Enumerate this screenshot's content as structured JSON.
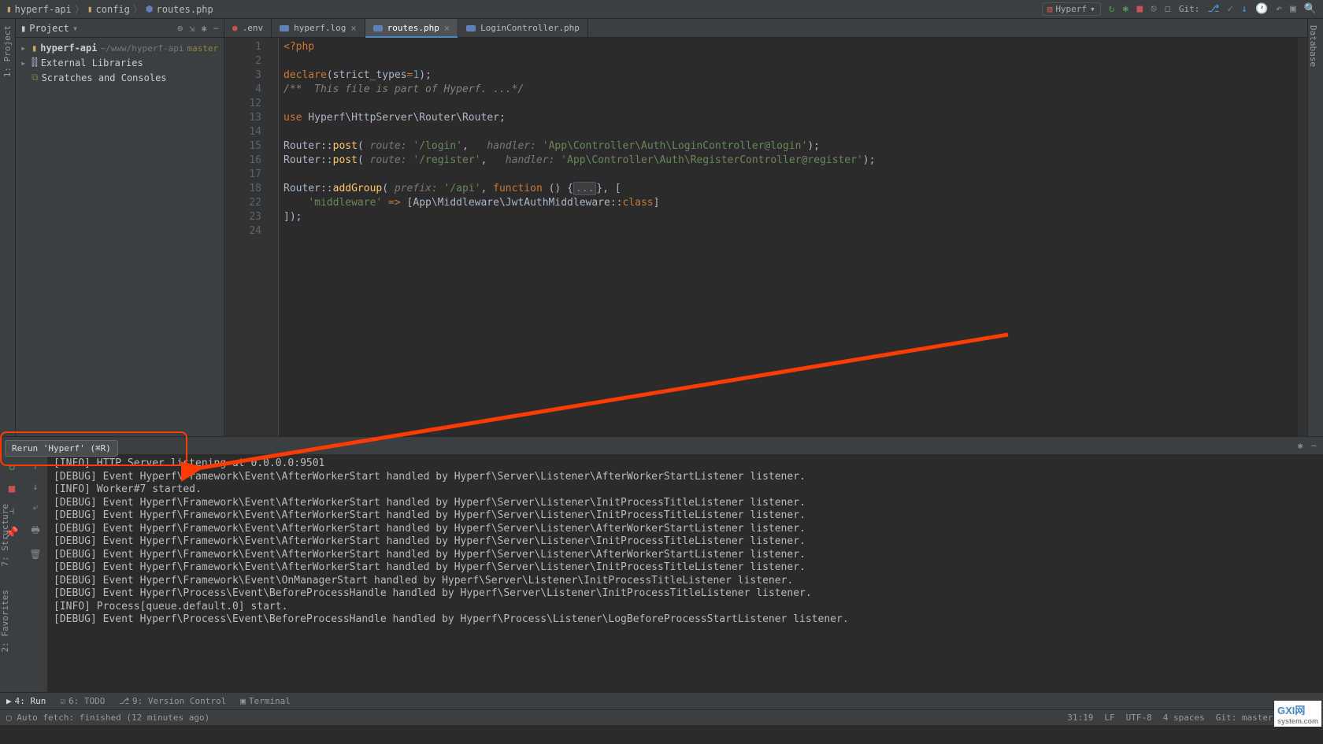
{
  "breadcrumbs": {
    "p1": "hyperf-api",
    "p2": "config",
    "p3": "routes.php"
  },
  "top_right": {
    "run_config": "Hyperf",
    "git_label": "Git:"
  },
  "project_header": {
    "title": "Project"
  },
  "tree": {
    "root_name": "hyperf-api",
    "root_path": "~/www/hyperf-api",
    "root_branch": "master",
    "ext_lib": "External Libraries",
    "scratches": "Scratches and Consoles"
  },
  "tabs": [
    {
      "name": ".env"
    },
    {
      "name": "hyperf.log"
    },
    {
      "name": "routes.php"
    },
    {
      "name": "LoginController.php"
    }
  ],
  "line_numbers": [
    "1",
    "2",
    "3",
    "4",
    "12",
    "13",
    "14",
    "15",
    "16",
    "17",
    "18",
    "22",
    "23",
    "24"
  ],
  "code": {
    "l1_php": "<?php",
    "l3_declare": "declare",
    "l3_strict": "strict_types",
    "l3_eq": "=",
    "l3_one": "1",
    "l4_comment": "/**  This file is part of Hyperf. ...*/",
    "l13_use": "use",
    "l13_ns": " Hyperf\\HttpServer\\Router\\Router;",
    "l15_router": "Router",
    "l15_post": "post",
    "l15_hint_route": " route: ",
    "l15_login": "'/login'",
    "l15_hint_handler": "  handler: ",
    "l15_ctrl": "'App\\Controller\\Auth\\LoginController@login'",
    "l16_register": "'/register'",
    "l16_ctrl": "'App\\Controller\\Auth\\RegisterController@register'",
    "l18_addgroup": "addGroup",
    "l18_hint_prefix": " prefix: ",
    "l18_api": "'/api'",
    "l18_function": "function",
    "l18_dots": "...",
    "l22_middleware": "'middleware'",
    "l22_arrow": " => ",
    "l22_ns": "[App\\Middleware\\JwtAuthMiddleware",
    "l22_class": "class",
    "l23_close": "]);"
  },
  "tooltip": "Rerun 'Hyperf' (⌘R)",
  "console_lines": [
    "[INFO] HTTP Server listening at 0.0.0.0:9501",
    "[DEBUG] Event Hyperf\\Framework\\Event\\AfterWorkerStart handled by Hyperf\\Server\\Listener\\AfterWorkerStartListener listener.",
    "[INFO] Worker#7 started.",
    "[DEBUG] Event Hyperf\\Framework\\Event\\AfterWorkerStart handled by Hyperf\\Server\\Listener\\InitProcessTitleListener listener.",
    "[DEBUG] Event Hyperf\\Framework\\Event\\AfterWorkerStart handled by Hyperf\\Server\\Listener\\InitProcessTitleListener listener.",
    "[DEBUG] Event Hyperf\\Framework\\Event\\AfterWorkerStart handled by Hyperf\\Server\\Listener\\AfterWorkerStartListener listener.",
    "[DEBUG] Event Hyperf\\Framework\\Event\\AfterWorkerStart handled by Hyperf\\Server\\Listener\\InitProcessTitleListener listener.",
    "[DEBUG] Event Hyperf\\Framework\\Event\\AfterWorkerStart handled by Hyperf\\Server\\Listener\\AfterWorkerStartListener listener.",
    "[DEBUG] Event Hyperf\\Framework\\Event\\AfterWorkerStart handled by Hyperf\\Server\\Listener\\InitProcessTitleListener listener.",
    "[DEBUG] Event Hyperf\\Framework\\Event\\OnManagerStart handled by Hyperf\\Server\\Listener\\InitProcessTitleListener listener.",
    "[DEBUG] Event Hyperf\\Process\\Event\\BeforeProcessHandle handled by Hyperf\\Server\\Listener\\InitProcessTitleListener listener.",
    "[INFO] Process[queue.default.0] start.",
    "[DEBUG] Event Hyperf\\Process\\Event\\BeforeProcessHandle handled by Hyperf\\Process\\Listener\\LogBeforeProcessStartListener listener."
  ],
  "bottom_tabs": {
    "run": "4: Run",
    "todo": "6: TODO",
    "vcs": "9: Version Control",
    "terminal": "Terminal"
  },
  "status": {
    "left": "Auto fetch: finished (12 minutes ago)",
    "pos": "31:19",
    "lf": "LF",
    "enc": "UTF-8",
    "indent": "4 spaces",
    "git": "Git: master"
  },
  "side_tabs": {
    "project": "1: Project",
    "structure": "7: Structure",
    "favorites": "2: Favorites",
    "database": "Database"
  },
  "watermark": {
    "main": "GXI网",
    "sub": "system.com"
  }
}
